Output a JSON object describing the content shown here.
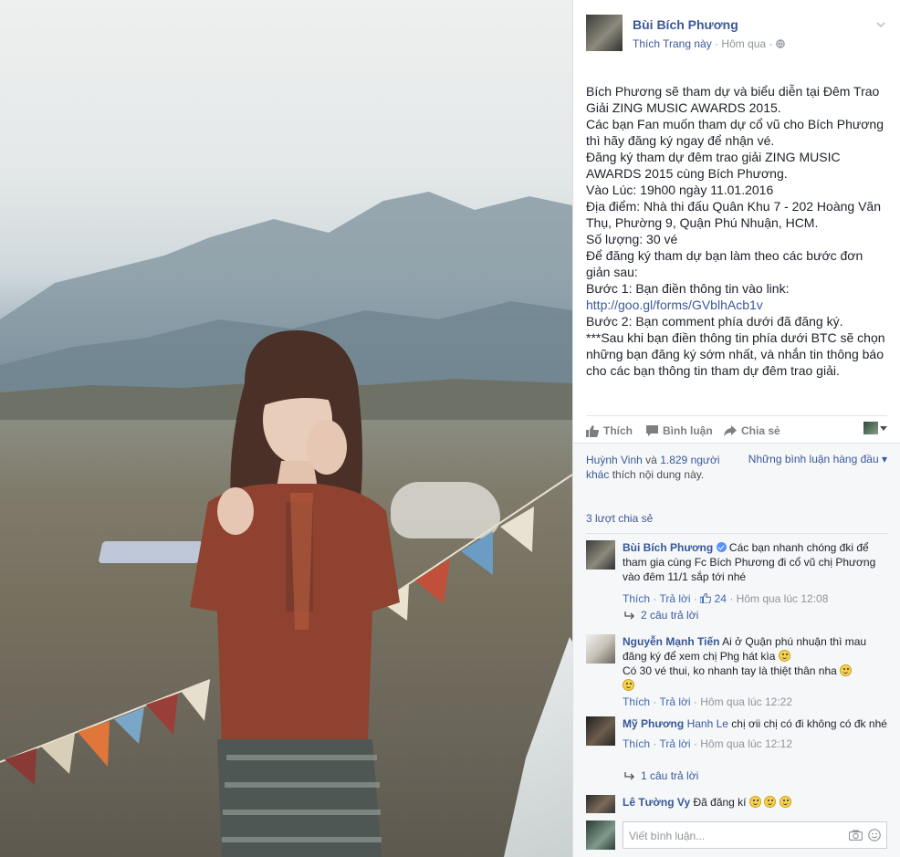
{
  "page": {
    "name": "Bùi Bích Phương",
    "like_page": "Thích Trang này",
    "dot1": "·",
    "time": "Hôm qua",
    "dot2": "·"
  },
  "post_lines": [
    "Bích Phương sẽ tham dự và biểu diễn tại Đêm Trao Giải ZING MUSIC AWARDS 2015.",
    "Các bạn Fan muốn tham dự cổ vũ cho Bích Phương thì hãy đăng ký ngay để nhận vé.",
    "Đăng ký tham dự đêm trao giải ZING MUSIC AWARDS 2015 cùng Bích Phương.",
    "Vào Lúc: 19h00 ngày 11.01.2016",
    "Địa điểm: Nhà thi đấu Quân Khu 7 - 202 Hoàng Văn Thụ, Phường 9, Quận Phú Nhuận, HCM.",
    "Số lượng: 30 vé",
    "Để đăng ký tham dự bạn làm theo các bước đơn giản sau:",
    "Bước 1: Bạn điền thông tin vào link:"
  ],
  "post_link": "http://goo.gl/forms/GVblhAcb1v",
  "post_lines_after": [
    "Bước 2: Bạn comment phía dưới đã đăng ký.",
    "***Sau khi bạn điền thông tin phía dưới BTC sẽ chọn những bạn đăng ký sớm nhất, và nhắn tin thông báo cho các bạn thông tin tham dự đêm trao giải."
  ],
  "actions": {
    "like": "Thích",
    "comment": "Bình luận",
    "share": "Chia sẻ"
  },
  "likes": {
    "name": "Huỳnh Vinh",
    "and": "và",
    "others": "1.829 người khác",
    "suffix": "thích nội dung này."
  },
  "sort_label": "Những bình luận hàng đầu",
  "sort_caret": "▾",
  "shares": "3 lượt chia sẻ",
  "comments": [
    {
      "name": "Bùi Bích Phương",
      "text": "Các bạn nhanh chóng đki để tham gia cùng Fc Bích Phương đi cổ vũ chị Phương vào đêm 11/1 sắp tới nhé",
      "like": "Thích",
      "reply": "Trả lời",
      "likes_count": "24",
      "time": "Hôm qua lúc 12:08",
      "replies": "2 câu trả lời",
      "sep": "·"
    },
    {
      "name": "Nguyễn Mạnh Tiến",
      "text1": "Ai ở Quận phú nhuận thì mau đăng ký để xem chị Phg hát kìa",
      "text2": "Có 30 vé thui, ko nhanh tay là thiệt thân nha",
      "like": "Thích",
      "reply": "Trả lời",
      "time": "Hôm qua lúc 12:22",
      "sep": "·"
    },
    {
      "name": "Mỹ Phương",
      "tag": "Hanh Le",
      "text": "chị ơii chị có đi không có đk nhé",
      "like": "Thích",
      "reply": "Trả lời",
      "time": "Hôm qua lúc 12:12",
      "replies": "1 câu trả lời",
      "sep": "·"
    },
    {
      "name": "Lê Tường Vy",
      "text": "Đã đăng kí"
    }
  ],
  "compose_placeholder": "Viết bình luận..."
}
